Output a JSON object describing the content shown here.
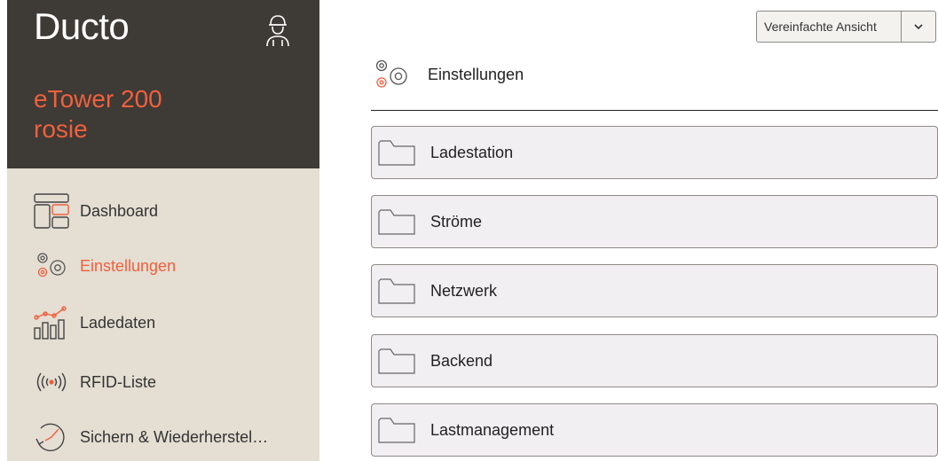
{
  "brand": {
    "name": "Ducto"
  },
  "device": {
    "model": "eTower 200",
    "name": "rosie"
  },
  "icons": {
    "user": "user-icon",
    "accent": "#f0603e"
  },
  "nav": [
    {
      "label": "Dashboard",
      "icon": "dashboard-icon",
      "active": false
    },
    {
      "label": "Einstellungen",
      "icon": "gears-icon",
      "active": true
    },
    {
      "label": "Ladedaten",
      "icon": "chart-icon",
      "active": false
    },
    {
      "label": "RFID-Liste",
      "icon": "rfid-icon",
      "active": false
    },
    {
      "label": "Sichern & Wiederherstel…",
      "icon": "backup-clock-icon",
      "active": false
    }
  ],
  "view_select": {
    "value": "Vereinfachte Ansicht"
  },
  "section": {
    "title": "Einstellungen"
  },
  "folders": [
    "Ladestation",
    "Ströme",
    "Netzwerk",
    "Backend",
    "Lastmanagement"
  ]
}
